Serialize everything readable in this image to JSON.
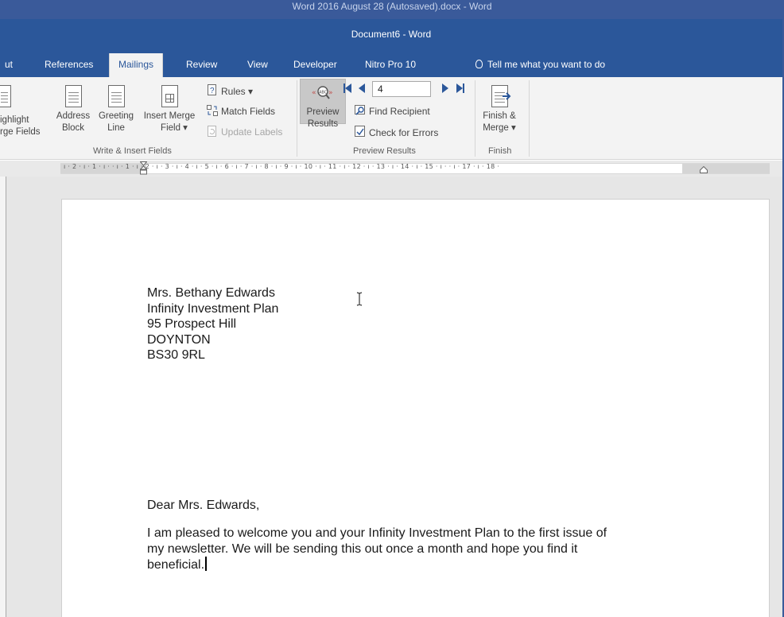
{
  "window": {
    "outer_title": "Word 2016 August 28 (Autosaved).docx  -  Word",
    "title": "Document6  -  Word"
  },
  "tabs": [
    {
      "label": "ut",
      "active": false
    },
    {
      "label": "References",
      "active": false
    },
    {
      "label": "Mailings",
      "active": true
    },
    {
      "label": "Review",
      "active": false
    },
    {
      "label": "View",
      "active": false
    },
    {
      "label": "Developer",
      "active": false
    },
    {
      "label": "Nitro Pro 10",
      "active": false
    }
  ],
  "tell_me": "Tell me what you want to do",
  "ribbon": {
    "write_insert": {
      "group_label": "Write & Insert Fields",
      "highlight": {
        "line1": "ighlight",
        "line2": "rge Fields"
      },
      "address_block": {
        "line1": "Address",
        "line2": "Block"
      },
      "greeting_line": {
        "line1": "Greeting",
        "line2": "Line"
      },
      "insert_merge_field": {
        "line1": "Insert Merge",
        "line2": "Field ▾"
      },
      "rules": "Rules ▾",
      "match_fields": "Match Fields",
      "update_labels": "Update Labels"
    },
    "preview_results": {
      "group_label": "Preview Results",
      "preview_button": {
        "line1": "Preview",
        "line2": "Results"
      },
      "record_number": "4",
      "find_recipient": "Find Recipient",
      "check_errors": "Check for Errors"
    },
    "finish": {
      "group_label": "Finish",
      "finish_merge": {
        "line1": "Finish &",
        "line2": "Merge ▾"
      }
    }
  },
  "ruler": {
    "labels": "ı · 2 · ı · 1 · ı ·      · ı · 1 · ı · 2 · ı · 3 · ı · 4 · ı · 5 · ı · 6 · ı · 7 · ı · 8 · ı · 9 · ı · 10 · ı · 11 · ı · 12 · ı · 13 · ı · 14 · ı · 15 · ı ·      · ı · 17 · ı · 18 ·"
  },
  "document": {
    "address": [
      "Mrs. Bethany Edwards",
      "Infinity Investment Plan",
      "95 Prospect Hill",
      "DOYNTON",
      "BS30 9RL"
    ],
    "salutation": "Dear Mrs. Edwards,",
    "body": [
      "I am pleased to welcome you and your  Infinity Investment Plan to the first issue of",
      "my newsletter. We will be sending this out once a month and hope you find it",
      "beneficial."
    ]
  },
  "colors": {
    "word_blue": "#2b579a",
    "ribbon_bg": "#f3f3f3",
    "workspace_bg": "#e6e6e6"
  }
}
